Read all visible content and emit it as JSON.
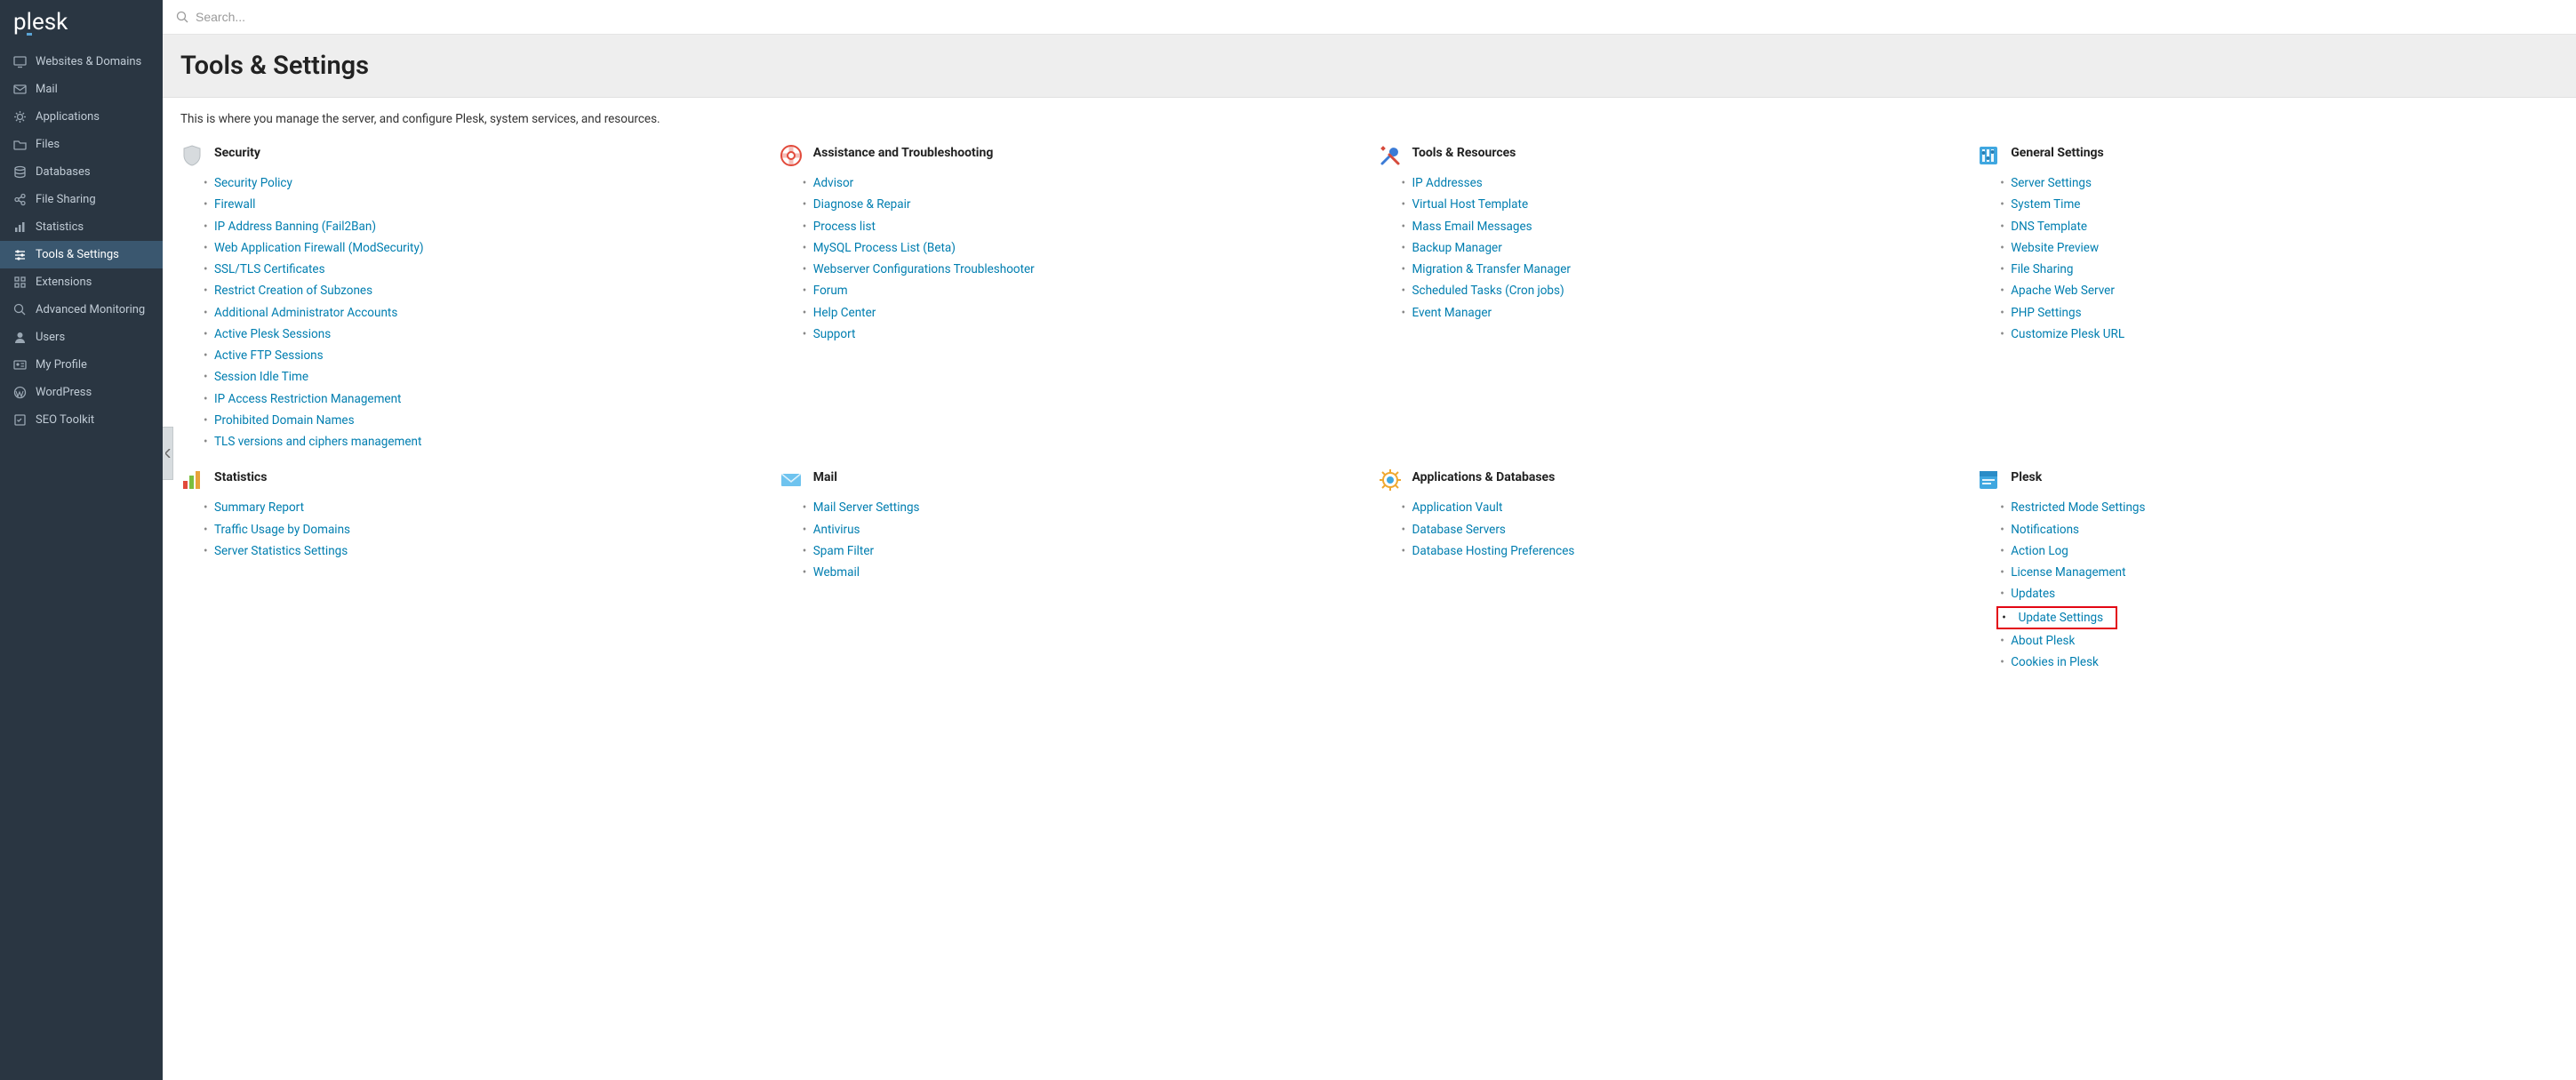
{
  "logo": "plesk",
  "search": {
    "placeholder": "Search..."
  },
  "page": {
    "title": "Tools & Settings",
    "intro": "This is where you manage the server, and configure Plesk, system services, and resources."
  },
  "sidebar": {
    "items": [
      {
        "key": "websites",
        "label": "Websites & Domains",
        "icon": "monitor"
      },
      {
        "key": "mail",
        "label": "Mail",
        "icon": "mail"
      },
      {
        "key": "apps",
        "label": "Applications",
        "icon": "gear"
      },
      {
        "key": "files",
        "label": "Files",
        "icon": "folder"
      },
      {
        "key": "databases",
        "label": "Databases",
        "icon": "stack"
      },
      {
        "key": "fileshare",
        "label": "File Sharing",
        "icon": "share"
      },
      {
        "key": "stats",
        "label": "Statistics",
        "icon": "bars"
      },
      {
        "key": "tools",
        "label": "Tools & Settings",
        "icon": "sliders",
        "active": true
      },
      {
        "key": "ext",
        "label": "Extensions",
        "icon": "grid"
      },
      {
        "key": "advmon",
        "label": "Advanced Monitoring",
        "icon": "magnify"
      },
      {
        "key": "users",
        "label": "Users",
        "icon": "user"
      },
      {
        "key": "profile",
        "label": "My Profile",
        "icon": "idcard"
      },
      {
        "key": "wp",
        "label": "WordPress",
        "icon": "wordpress"
      },
      {
        "key": "seo",
        "label": "SEO Toolkit",
        "icon": "checklist"
      }
    ]
  },
  "groups_row1": {
    "security": {
      "title": "Security",
      "icon_color": "#c5c9cc",
      "items": [
        "Security Policy",
        "Firewall",
        "IP Address Banning (Fail2Ban)",
        "Web Application Firewall (ModSecurity)",
        "SSL/TLS Certificates",
        "Restrict Creation of Subzones",
        "Additional Administrator Accounts",
        "Active Plesk Sessions",
        "Active FTP Sessions",
        "Session Idle Time",
        "IP Access Restriction Management",
        "Prohibited Domain Names",
        "TLS versions and ciphers management"
      ]
    },
    "assist": {
      "title": "Assistance and Troubleshooting",
      "items": [
        "Advisor",
        "Diagnose & Repair",
        "Process list",
        "MySQL Process List (Beta)",
        "Webserver Configurations Troubleshooter",
        "Forum",
        "Help Center",
        "Support"
      ]
    },
    "tools": {
      "title": "Tools & Resources",
      "items": [
        "IP Addresses",
        "Virtual Host Template",
        "Mass Email Messages",
        "Backup Manager",
        "Migration & Transfer Manager",
        "Scheduled Tasks (Cron jobs)",
        "Event Manager"
      ]
    },
    "general": {
      "title": "General Settings",
      "items": [
        "Server Settings",
        "System Time",
        "DNS Template",
        "Website Preview",
        "File Sharing",
        "Apache Web Server",
        "PHP Settings",
        "Customize Plesk URL"
      ]
    }
  },
  "groups_row2": {
    "statistics": {
      "title": "Statistics",
      "items": [
        "Summary Report",
        "Traffic Usage by Domains",
        "Server Statistics Settings"
      ]
    },
    "mail": {
      "title": "Mail",
      "items": [
        "Mail Server Settings",
        "Antivirus",
        "Spam Filter",
        "Webmail"
      ]
    },
    "appsdb": {
      "title": "Applications & Databases",
      "items": [
        "Application Vault",
        "Database Servers",
        "Database Hosting Preferences"
      ]
    },
    "plesk": {
      "title": "Plesk",
      "items": [
        "Restricted Mode Settings",
        "Notifications",
        "Action Log",
        "License Management",
        "Updates",
        "Update Settings",
        "About Plesk",
        "Cookies in Plesk"
      ],
      "highlight_index": 5
    }
  }
}
